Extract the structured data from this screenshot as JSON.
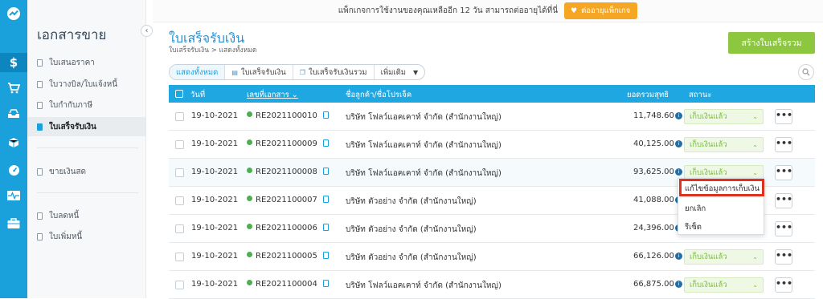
{
  "banner": {
    "text": "แพ็กเกจการใช้งานของคุณเหลืออีก 12 วัน สามารถต่ออายุได้ที่นี่",
    "button": "ต่ออายุแพ็กเกจ"
  },
  "sidebar": {
    "title": "เอกสารขาย",
    "items": [
      {
        "label": "ใบเสนอราคา"
      },
      {
        "label": "ใบวางบิล/ใบแจ้งหนี้"
      },
      {
        "label": "ใบกำกับภาษี"
      },
      {
        "label": "ใบเสร็จรับเงิน"
      },
      {
        "label": "ขายเงินสด"
      },
      {
        "label": "ใบลดหนี้"
      },
      {
        "label": "ใบเพิ่มหนี้"
      }
    ]
  },
  "page": {
    "title": "ใบเสร็จรับเงิน",
    "breadcrumb": "ใบเสร็จรับเงิน > แสดงทั้งหมด",
    "create_button": "สร้างใบเสร็จรวม"
  },
  "filters": [
    "แสดงทั้งหมด",
    "ใบเสร็จรับเงิน",
    "ใบเสร็จรับเงินรวม",
    "เพิ่มเติม"
  ],
  "table": {
    "headers": {
      "date": "วันที่",
      "doc": "เลขที่เอกสาร",
      "customer": "ชื่อลูกค้า/ชื่อโปรเจ็ค",
      "total": "ยอดรวมสุทธิ",
      "status": "สถานะ"
    },
    "rows": [
      {
        "date": "19-10-2021",
        "doc": "RE2021100010",
        "customer": "บริษัท โฟลว์แอคเคาท์ จำกัด (สำนักงานใหญ่)",
        "total": "11,748.60",
        "status": "เก็บเงินแล้ว"
      },
      {
        "date": "19-10-2021",
        "doc": "RE2021100009",
        "customer": "บริษัท โฟลว์แอคเคาท์ จำกัด (สำนักงานใหญ่)",
        "total": "40,125.00",
        "status": "เก็บเงินแล้ว"
      },
      {
        "date": "19-10-2021",
        "doc": "RE2021100008",
        "customer": "บริษัท โฟลว์แอคเคาท์ จำกัด (สำนักงานใหญ่)",
        "total": "93,625.00",
        "status": "เก็บเงินแล้ว"
      },
      {
        "date": "19-10-2021",
        "doc": "RE2021100007",
        "customer": "บริษัท ตัวอย่าง จำกัด (สำนักงานใหญ่)",
        "total": "41,088.00"
      },
      {
        "date": "19-10-2021",
        "doc": "RE2021100006",
        "customer": "บริษัท ตัวอย่าง จำกัด (สำนักงานใหญ่)",
        "total": "24,396.00"
      },
      {
        "date": "19-10-2021",
        "doc": "RE2021100005",
        "customer": "บริษัท ตัวอย่าง จำกัด (สำนักงานใหญ่)",
        "total": "66,126.00",
        "status": "เก็บเงินแล้ว"
      },
      {
        "date": "19-10-2021",
        "doc": "RE2021100004",
        "customer": "บริษัท โฟลว์แอคเคาท์ จำกัด (สำนักงานใหญ่)",
        "total": "66,875.00",
        "status": "เก็บเงินแล้ว"
      }
    ]
  },
  "dropdown": {
    "items": [
      "แก้ไขข้อมูลการเก็บเงิน",
      "ยกเลิก",
      "รีเซ็ต"
    ]
  },
  "colors": {
    "brand": "#1aa1dc",
    "create": "#8dc63f",
    "banner_button": "#f5a623",
    "status": "#7bbf3b",
    "highlight": "#e0301e"
  }
}
